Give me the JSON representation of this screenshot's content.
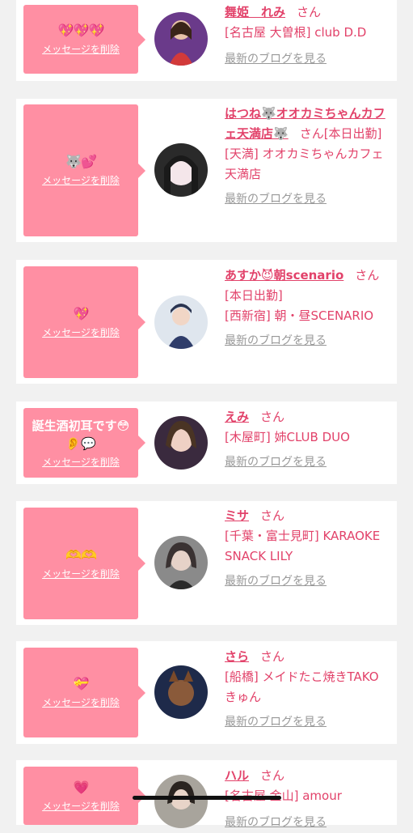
{
  "accent_color": "#ff8fa3",
  "text_color": "#e2426a",
  "cards": [
    {
      "message": "💖💖💖",
      "delete_label": "メッセージを削除",
      "name": "舞姫　れみ",
      "san": "さん",
      "detail": "[名古屋 大曽根] club D.D",
      "blog_label": "最新のブログを見る"
    },
    {
      "message": "🐺💕",
      "delete_label": "メッセージを削除",
      "name": "はつね🐺オオカミちゃんカフェ天満店🐺",
      "san": "さん",
      "status": "[本日出勤]",
      "detail": "[天満] オオカミちゃんカフェ天満店",
      "blog_label": "最新のブログを見る"
    },
    {
      "message": "💖",
      "delete_label": "メッセージを削除",
      "name": "あすか😈朝scenario",
      "san": "さん",
      "status": "[本日出勤]",
      "detail": "[西新宿] 朝・昼SCENARIO",
      "blog_label": "最新のブログを見る"
    },
    {
      "message": "誕生酒初耳です😳👂💬",
      "delete_label": "メッセージを削除",
      "name": "えみ",
      "san": "さん",
      "detail": "[木屋町] 姉CLUB DUO",
      "blog_label": "最新のブログを見る"
    },
    {
      "message": "🫶🫶",
      "delete_label": "メッセージを削除",
      "name": "ミサ",
      "san": "さん",
      "detail": "[千葉・富士見町] KARAOKE SNACK LILY",
      "blog_label": "最新のブログを見る"
    },
    {
      "message": "💝",
      "delete_label": "メッセージを削除",
      "name": "さら",
      "san": "さん",
      "detail": "[船橋] メイドたこ焼きTAKOきゅん",
      "blog_label": "最新のブログを見る"
    },
    {
      "message": "💗",
      "delete_label": "メッセージを削除",
      "name": "ハル",
      "san": "さん",
      "detail": "[名古屋 金山] amour",
      "blog_label": "最新のブログを見る"
    }
  ]
}
